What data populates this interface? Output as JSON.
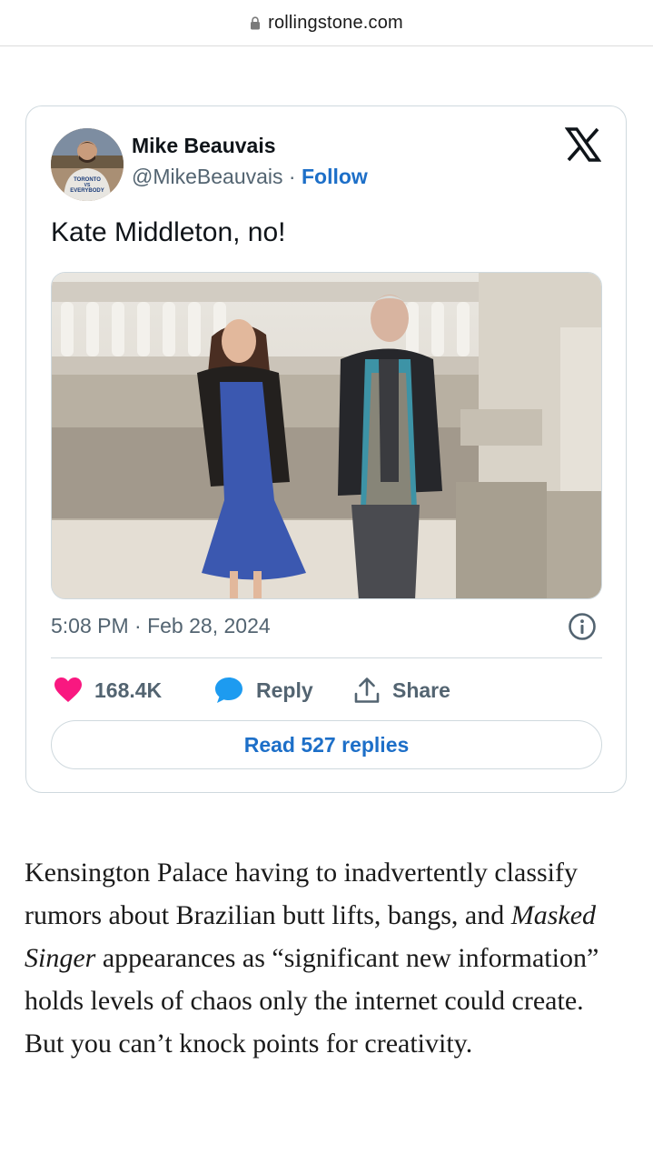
{
  "browser": {
    "domain": "rollingstone.com"
  },
  "tweet": {
    "author_name": "Mike Beauvais",
    "handle": "@MikeBeauvais",
    "separator": " · ",
    "follow_label": "Follow",
    "text": "Kate Middleton, no!",
    "timestamp": "5:08 PM · Feb 28, 2024",
    "like_count": "168.4K",
    "reply_label": "Reply",
    "share_label": "Share",
    "read_replies_label": "Read 527 replies",
    "avatar_shirt_text": [
      "TORONTO",
      "VS",
      "EVERYBODY"
    ]
  },
  "article": {
    "p1_a": "Kensington Palace having to inadvertently classify rumors about Brazilian butt lifts, bangs, and ",
    "p1_em": "Masked Singer",
    "p1_b": " appearances as “significant new information” holds levels of chaos only the internet could create. But you can’t knock points for creativity."
  },
  "colors": {
    "link_blue": "#1d6fc8",
    "like_pink": "#f91880",
    "reply_blue": "#1d9bf0",
    "muted_gray": "#536471",
    "border_gray": "#cfd9de"
  },
  "icons": [
    "lock-icon",
    "x-logo-icon",
    "info-icon",
    "heart-icon",
    "speech-bubble-icon",
    "share-icon"
  ]
}
